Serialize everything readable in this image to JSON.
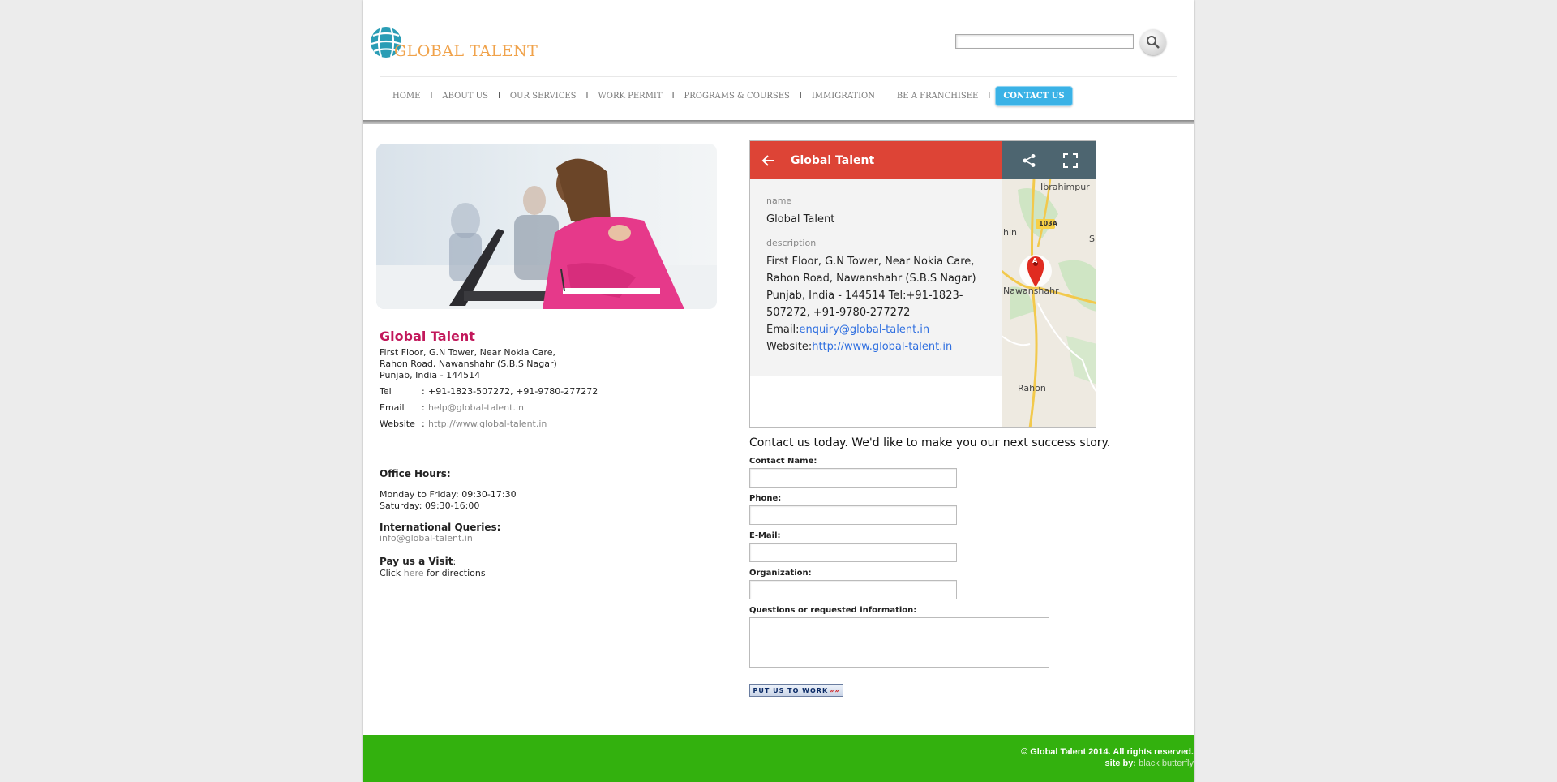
{
  "brand": {
    "name": "GLOBAL TALENT"
  },
  "search": {
    "placeholder": ""
  },
  "nav": {
    "items": [
      "HOME",
      "ABOUT US",
      "OUR SERVICES",
      "WORK PERMIT",
      "PROGRAMS & COURSES",
      "IMMIGRATION",
      "BE A FRANCHISEE",
      "CONTACT US"
    ],
    "separator": "I",
    "active": "CONTACT US"
  },
  "contact": {
    "company": "Global Talent",
    "address_lines": [
      "First Floor, G.N Tower, Near Nokia Care,",
      "Rahon Road, Nawanshahr (S.B.S Nagar)",
      "Punjab, India - 144514"
    ],
    "tel_label": "Tel",
    "tel_value": "+91-1823-507272, +91-9780-277272",
    "email_label": "Email",
    "email_value": "help@global-talent.in",
    "website_label": "Website",
    "website_value": "http://www.global-talent.in",
    "colon": ":"
  },
  "office": {
    "hours_title": "Office Hours:",
    "weekday": "Monday to Friday: 09:30-17:30",
    "saturday": "Saturday: 09:30-16:00",
    "intl_title": "International Queries:",
    "intl_email": "info@global-talent.in",
    "visit_title": "Pay us a Visit",
    "visit_colon": ":",
    "visit_prefix": "Click",
    "visit_link": "here",
    "visit_suffix": "for directions"
  },
  "map": {
    "title": "Global Talent",
    "name_label": "name",
    "name_value": "Global Talent",
    "desc_label": "description",
    "desc_lines": [
      "First Floor, G.N Tower, Near Nokia Care,",
      "Rahon Road, Nawanshahr (S.B.S Nagar)",
      "Punjab, India - 144514 Tel:+91-1823-",
      "507272, +91-9780-277272"
    ],
    "email_prefix": "Email:",
    "email_link": "enquiry@global-talent.in",
    "website_prefix": "Website:",
    "website_link": "http://www.global-talent.in",
    "place_labels": {
      "top": "Ibrahimpur",
      "left": "hin",
      "road": "103A",
      "city": "Nawanshahr",
      "south": "Rahon",
      "edge": "S",
      "marker": "A"
    }
  },
  "form": {
    "heading": "Contact us today. We'd like to make you our next success story.",
    "fields": [
      "Contact Name:",
      "Phone:",
      "E-Mail:",
      "Organization:"
    ],
    "textarea_label": "Questions or requested information:",
    "submit": "Put us to work",
    "submit_arrows": "»»"
  },
  "footer": {
    "copyright": "© Global Talent 2014. All rights reserved.",
    "site_by_prefix": "site by:",
    "site_by_link": "black butterfly"
  },
  "colors": {
    "brand_orange": "#f0a24a",
    "nav_active": "#3ab2e6",
    "company_title": "#c2185b",
    "map_header": "#dd4436",
    "map_tools": "#4d6570",
    "footer_green": "#33b10e"
  }
}
